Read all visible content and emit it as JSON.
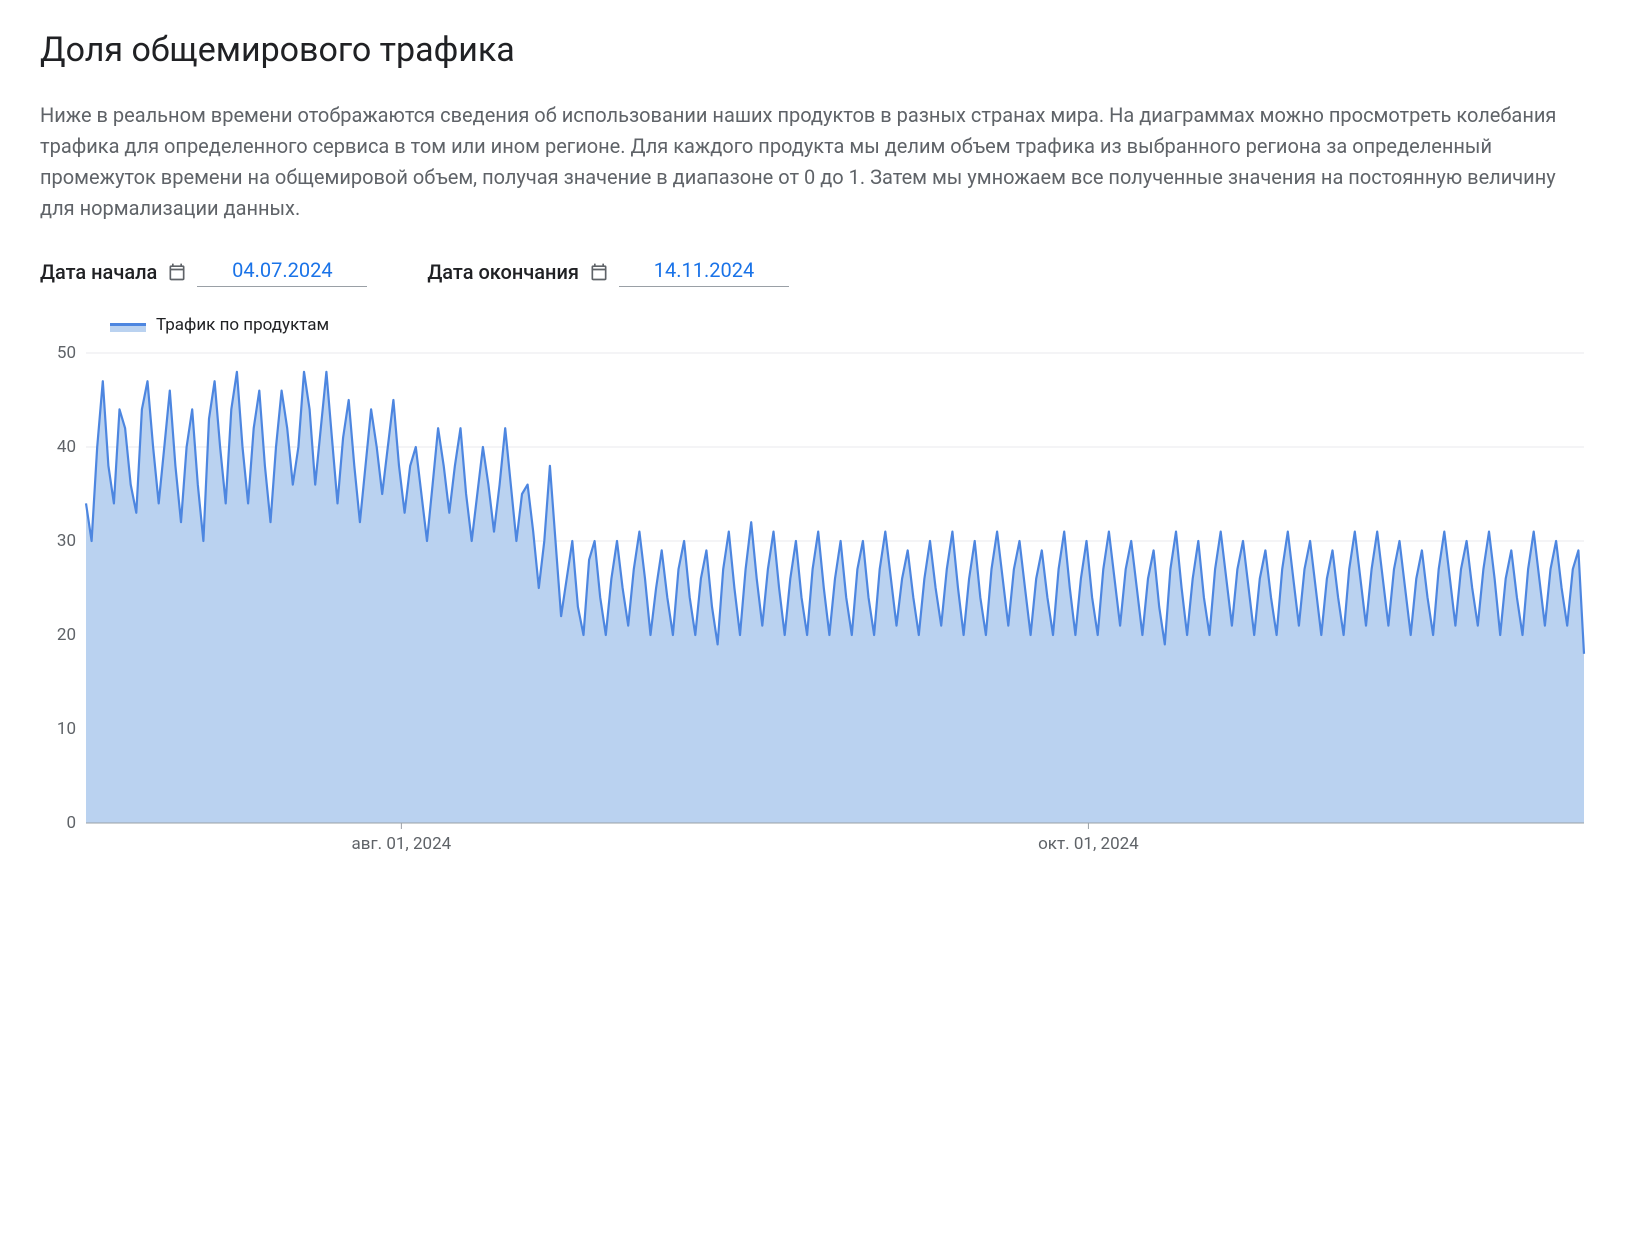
{
  "title": "Доля общемирового трафика",
  "description": "Ниже в реальном времени отображаются сведения об использовании наших продуктов в разных странах мира. На диаграммах можно просмотреть колебания трафика для определенного сервиса в том или ином регионе. Для каждого продукта мы делим объем трафика из выбранного региона за определенный промежуток времени на общемировой объем, получая значение в диапазоне от 0 до 1. Затем мы умножаем все полученные значения на постоянную величину для нормализации данных.",
  "date_start": {
    "label": "Дата начала",
    "value": "04.07.2024"
  },
  "date_end": {
    "label": "Дата окончания",
    "value": "14.11.2024"
  },
  "legend": {
    "label": "Трафик по продуктам"
  },
  "chart_data": {
    "type": "area",
    "ylim": [
      0,
      50
    ],
    "yticks": [
      0,
      10,
      20,
      30,
      40,
      50
    ],
    "x_start": "2024-07-04",
    "x_end": "2024-11-14",
    "x_tick_labels": [
      {
        "date": "2024-08-01",
        "label": "авг. 01, 2024"
      },
      {
        "date": "2024-10-01",
        "label": "окт. 01, 2024"
      }
    ],
    "series": [
      {
        "name": "Трафик по продуктам",
        "values": [
          34,
          30,
          40,
          47,
          38,
          34,
          44,
          42,
          36,
          33,
          44,
          47,
          40,
          34,
          40,
          46,
          38,
          32,
          40,
          44,
          36,
          30,
          43,
          47,
          40,
          34,
          44,
          48,
          40,
          34,
          42,
          46,
          38,
          32,
          40,
          46,
          42,
          36,
          40,
          48,
          44,
          36,
          42,
          48,
          41,
          34,
          41,
          45,
          38,
          32,
          38,
          44,
          40,
          35,
          40,
          45,
          38,
          33,
          38,
          40,
          35,
          30,
          36,
          42,
          38,
          33,
          38,
          42,
          35,
          30,
          35,
          40,
          36,
          31,
          36,
          42,
          36,
          30,
          35,
          36,
          31,
          25,
          30,
          38,
          30,
          22,
          26,
          30,
          23,
          20,
          28,
          30,
          24,
          20,
          26,
          30,
          25,
          21,
          27,
          31,
          26,
          20,
          25,
          29,
          24,
          20,
          27,
          30,
          24,
          20,
          26,
          29,
          23,
          19,
          27,
          31,
          25,
          20,
          27,
          32,
          26,
          21,
          27,
          31,
          25,
          20,
          26,
          30,
          24,
          20,
          27,
          31,
          25,
          20,
          26,
          30,
          24,
          20,
          27,
          30,
          24,
          20,
          27,
          31,
          26,
          21,
          26,
          29,
          24,
          20,
          26,
          30,
          25,
          21,
          27,
          31,
          25,
          20,
          26,
          30,
          24,
          20,
          27,
          31,
          26,
          21,
          27,
          30,
          25,
          20,
          26,
          29,
          24,
          20,
          27,
          31,
          25,
          20,
          26,
          30,
          24,
          20,
          27,
          31,
          26,
          21,
          27,
          30,
          25,
          20,
          26,
          29,
          23,
          19,
          27,
          31,
          25,
          20,
          26,
          30,
          24,
          20,
          27,
          31,
          26,
          21,
          27,
          30,
          25,
          20,
          26,
          29,
          24,
          20,
          27,
          31,
          26,
          21,
          27,
          30,
          25,
          20,
          26,
          29,
          24,
          20,
          27,
          31,
          26,
          21,
          27,
          31,
          26,
          21,
          27,
          30,
          25,
          20,
          26,
          29,
          24,
          20,
          27,
          31,
          26,
          21,
          27,
          30,
          25,
          21,
          27,
          31,
          26,
          20,
          26,
          29,
          24,
          20,
          27,
          31,
          26,
          21,
          27,
          30,
          25,
          21,
          27,
          29,
          18
        ]
      }
    ]
  }
}
